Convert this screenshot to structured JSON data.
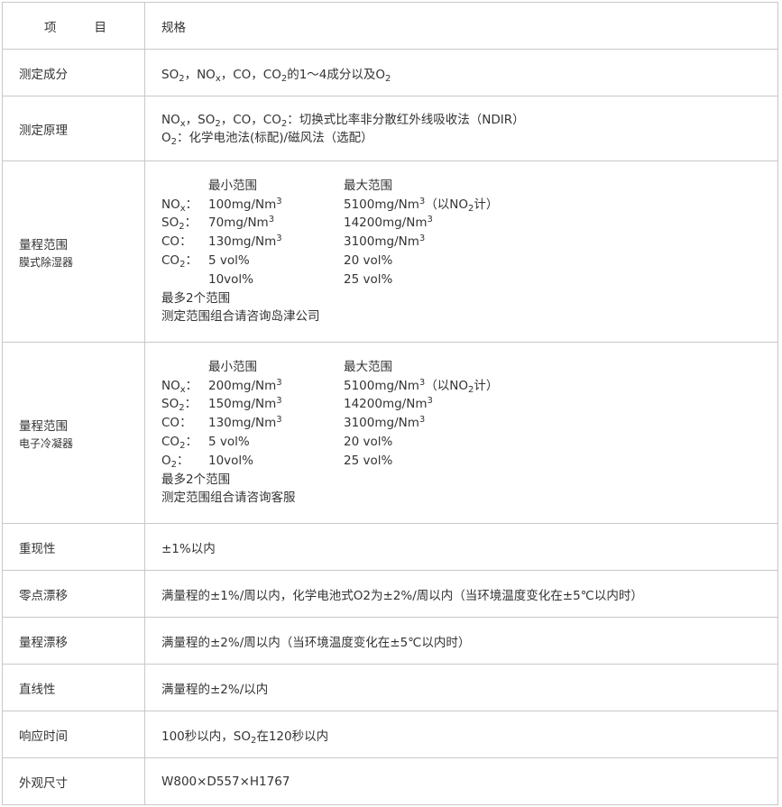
{
  "header": {
    "col1_part1": "项",
    "col1_part2": "目",
    "col2": "规格"
  },
  "rows": {
    "measure_components": {
      "label": "测定成分",
      "value": {
        "so": "SO",
        "so_sub": "2",
        "sep1": "，NO",
        "nox_sub": "x",
        "sep2": "，CO，CO",
        "co2_sub": "2",
        "tail": "的1～4成分以及O",
        "o2_sub": "2"
      }
    },
    "measure_principle": {
      "label": "测定原理",
      "line1": {
        "a": "NO",
        "a_sub": "x",
        "b": "，SO",
        "b_sub": "2",
        "c": "，CO，CO",
        "c_sub": "2",
        "d": "：切换式比率非分散红外线吸收法（NDIR）"
      },
      "line2": {
        "a": "O",
        "a_sub": "2",
        "b": "：化学电池法(标配)/磁风法（选配）"
      }
    },
    "range_membrane": {
      "label": "量程范围",
      "sublabel": "膜式除湿器",
      "min_header": "最小范围",
      "max_header": "最大范围",
      "items": [
        {
          "gas": "NO",
          "gas_sub": "x",
          "min": "100mg/Nm",
          "min_sup": "3",
          "max": "5100mg/Nm",
          "max_sup": "3",
          "max_note_pre": "（以NO",
          "max_note_sub": "2",
          "max_note_post": "计）"
        },
        {
          "gas": "SO",
          "gas_sub": "2",
          "min": "70mg/Nm",
          "min_sup": "3",
          "max": "14200mg/Nm",
          "max_sup": "3"
        },
        {
          "gas": "CO",
          "gas_sub": "",
          "min": "130mg/Nm",
          "min_sup": "3",
          "max": "3100mg/Nm",
          "max_sup": "3"
        },
        {
          "gas": "CO",
          "gas_sub": "2",
          "min": "5 vol%",
          "min_sup": "",
          "max": "20 vol%",
          "max_sup": ""
        },
        {
          "gas": "",
          "gas_sub": "",
          "min": "10vol%",
          "min_sup": "",
          "max": "25 vol%",
          "max_sup": ""
        }
      ],
      "note1": "最多2个范围",
      "note2": "测定范围组合请咨询岛津公司"
    },
    "range_cooler": {
      "label": "量程范围",
      "sublabel": "电子冷凝器",
      "min_header": "最小范围",
      "max_header": "最大范围",
      "items": [
        {
          "gas": "NO",
          "gas_sub": "x",
          "min": "200mg/Nm",
          "min_sup": "3",
          "max": "5100mg/Nm",
          "max_sup": "3",
          "max_note_pre": "（以NO",
          "max_note_sub": "2",
          "max_note_post": "计）"
        },
        {
          "gas": "SO",
          "gas_sub": "2",
          "min": "150mg/Nm",
          "min_sup": "3",
          "max": "14200mg/Nm",
          "max_sup": "3"
        },
        {
          "gas": "CO",
          "gas_sub": "",
          "min": "130mg/Nm",
          "min_sup": "3",
          "max": "3100mg/Nm",
          "max_sup": "3"
        },
        {
          "gas": "CO",
          "gas_sub": "2",
          "min": "5 vol%",
          "min_sup": "",
          "max": "20 vol%",
          "max_sup": ""
        },
        {
          "gas": "O",
          "gas_sub": "2",
          "min": "10vol%",
          "min_sup": "",
          "max": "25 vol%",
          "max_sup": ""
        }
      ],
      "note1": "最多2个范围",
      "note2": "测定范围组合请咨询客服"
    },
    "repeatability": {
      "label": "重现性",
      "value": "±1%以内"
    },
    "zero_drift": {
      "label": "零点漂移",
      "value": "满量程的±1%/周以内，化学电池式O2为±2%/周以内（当环境温度变化在±5℃以内时）"
    },
    "span_drift": {
      "label": "量程漂移",
      "value": "满量程的±2%/周以内（当环境温度变化在±5℃以内时）"
    },
    "linearity": {
      "label": "直线性",
      "value": "满量程的±2%/以内"
    },
    "response_time": {
      "label": "响应时间",
      "value": {
        "a": "100秒以内，SO",
        "a_sub": "2",
        "b": "在120秒以内"
      }
    },
    "dimensions": {
      "label": "外观尺寸",
      "value": "W800×D557×H1767"
    }
  }
}
